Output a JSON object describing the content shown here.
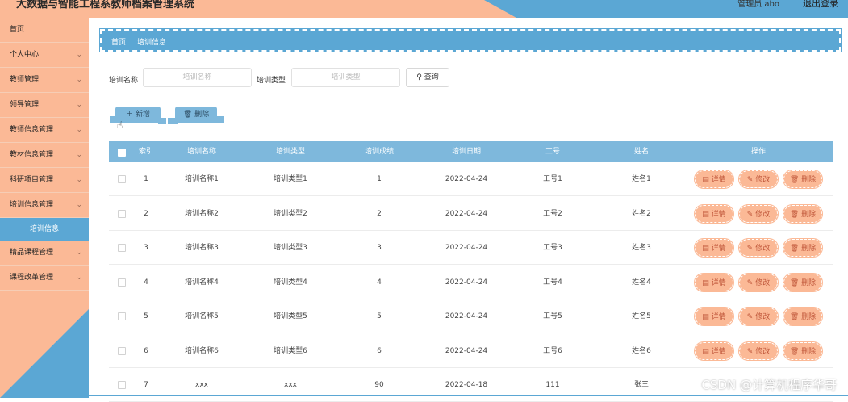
{
  "header": {
    "title": "大数据与智能工程系教师档案管理系统",
    "user": "管理员 abo",
    "logout": "退出登录"
  },
  "sidebar": {
    "items": [
      {
        "label": "首页",
        "has_children": false
      },
      {
        "label": "个人中心",
        "has_children": true
      },
      {
        "label": "教师管理",
        "has_children": true
      },
      {
        "label": "领导管理",
        "has_children": true
      },
      {
        "label": "教师信息管理",
        "has_children": true
      },
      {
        "label": "教材信息管理",
        "has_children": true
      },
      {
        "label": "科研项目管理",
        "has_children": true
      },
      {
        "label": "培训信息管理",
        "has_children": true,
        "expanded": true
      },
      {
        "label": "精品课程管理",
        "has_children": true
      },
      {
        "label": "课程改革管理",
        "has_children": true
      }
    ],
    "active_sub": "培训信息",
    "chevron": "⌄"
  },
  "breadcrumb": {
    "home": "首页",
    "separator": "|",
    "current": "培训信息"
  },
  "search": {
    "name_label": "培训名称",
    "name_placeholder": "培训名称",
    "type_label": "培训类型",
    "type_placeholder": "培训类型",
    "query_button": "查询",
    "search_icon": "search-icon"
  },
  "actions": {
    "add": "新增",
    "delete": "删除"
  },
  "table": {
    "columns": [
      "索引",
      "培训名称",
      "培训类型",
      "培训成绩",
      "培训日期",
      "工号",
      "姓名",
      "操作"
    ],
    "rows": [
      {
        "index": "1",
        "name": "培训名称1",
        "type": "培训类型1",
        "score": "1",
        "date": "2022-04-24",
        "job_no": "工号1",
        "person": "姓名1"
      },
      {
        "index": "2",
        "name": "培训名称2",
        "type": "培训类型2",
        "score": "2",
        "date": "2022-04-24",
        "job_no": "工号2",
        "person": "姓名2"
      },
      {
        "index": "3",
        "name": "培训名称3",
        "type": "培训类型3",
        "score": "3",
        "date": "2022-04-24",
        "job_no": "工号3",
        "person": "姓名3"
      },
      {
        "index": "4",
        "name": "培训名称4",
        "type": "培训类型4",
        "score": "4",
        "date": "2022-04-24",
        "job_no": "工号4",
        "person": "姓名4"
      },
      {
        "index": "5",
        "name": "培训名称5",
        "type": "培训类型5",
        "score": "5",
        "date": "2022-04-24",
        "job_no": "工号5",
        "person": "姓名5"
      },
      {
        "index": "6",
        "name": "培训名称6",
        "type": "培训类型6",
        "score": "6",
        "date": "2022-04-24",
        "job_no": "工号6",
        "person": "姓名6"
      },
      {
        "index": "7",
        "name": "xxx",
        "type": "xxx",
        "score": "90",
        "date": "2022-04-18",
        "job_no": "111",
        "person": "张三"
      }
    ],
    "row_actions": {
      "detail": "详情",
      "edit": "修改",
      "delete": "删除"
    }
  },
  "watermark": "CSDN @计算机程序华哥",
  "colors": {
    "peach": "#fbb996",
    "blue": "#5ba7d4",
    "table_header": "#7eb8dc"
  }
}
